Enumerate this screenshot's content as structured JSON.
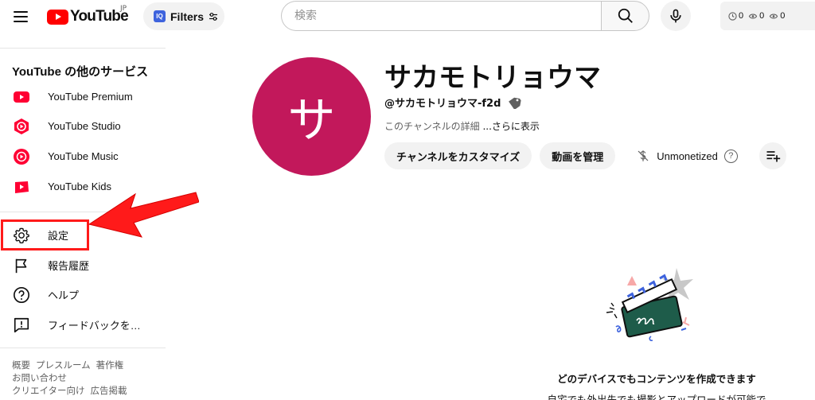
{
  "header": {
    "logo_text": "YouTube",
    "country_code": "JP",
    "filters_label": "Filters",
    "iq_badge": "IQ",
    "search_placeholder": "検索",
    "stats": [
      "0",
      "0",
      "0"
    ]
  },
  "sidebar": {
    "section_title": "YouTube の他のサービス",
    "services": [
      {
        "label": "YouTube Premium",
        "icon": "youtube-premium-icon"
      },
      {
        "label": "YouTube Studio",
        "icon": "youtube-studio-icon"
      },
      {
        "label": "YouTube Music",
        "icon": "youtube-music-icon"
      },
      {
        "label": "YouTube Kids",
        "icon": "youtube-kids-icon"
      }
    ],
    "items": [
      {
        "label": "設定",
        "icon": "gear-icon"
      },
      {
        "label": "報告履歴",
        "icon": "flag-icon"
      },
      {
        "label": "ヘルプ",
        "icon": "help-icon"
      },
      {
        "label": "フィードバックを…",
        "icon": "feedback-icon"
      }
    ],
    "footer_links": [
      "概要",
      "プレスルーム",
      "著作権",
      "お問い合わせ",
      "クリエイター向け",
      "広告掲載"
    ]
  },
  "channel": {
    "avatar_letter": "サ",
    "avatar_color": "#c2185b",
    "name": "サカモトリョウマ",
    "handle": "@サカモトリョウマ-f2d",
    "description": "このチャンネルの詳細",
    "more_link": "...さらに表示",
    "customize_button": "チャンネルをカスタマイズ",
    "manage_button": "動画を管理",
    "monetization_status": "Unmonetized"
  },
  "empty_state": {
    "title": "どのデバイスでもコンテンツを作成できます",
    "subtitle": "自宅でも外出先でも撮影とアップロードが可能で"
  },
  "colors": {
    "brand_red": "#ff0000",
    "annotation_red": "#ff1a1a",
    "iq_blue": "#3e63dd"
  }
}
